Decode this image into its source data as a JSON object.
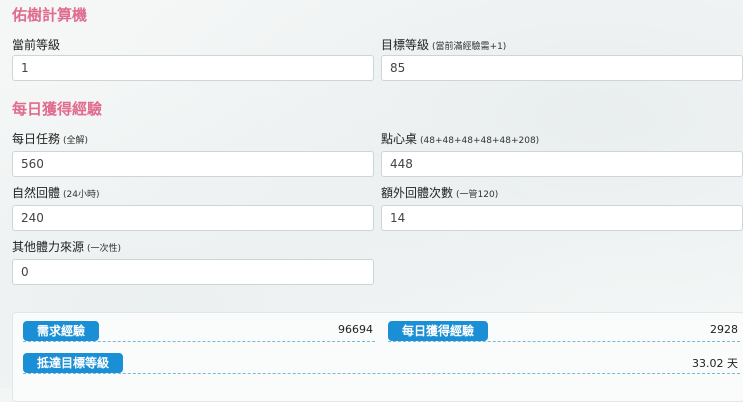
{
  "calculator": {
    "title": "佑樹計算機",
    "current_level_label": "當前等級",
    "current_level_value": "1",
    "target_level_label": "目標等級",
    "target_level_hint": "(當前滿經驗需+1)",
    "target_level_value": "85"
  },
  "daily_exp": {
    "title": "每日獲得經驗",
    "daily_tasks_label": "每日任務",
    "daily_tasks_hint": "(全解)",
    "daily_tasks_value": "560",
    "snacks_label": "點心桌",
    "snacks_hint": "(48+48+48+48+48+208)",
    "snacks_value": "448",
    "natural_recovery_label": "自然回體",
    "natural_recovery_hint": "(24小時)",
    "natural_recovery_value": "240",
    "extra_recovery_label": "額外回體次數",
    "extra_recovery_hint": "(一管120)",
    "extra_recovery_value": "14",
    "other_stamina_label": "其他體力來源",
    "other_stamina_hint": "(一次性)",
    "other_stamina_value": "0"
  },
  "results": {
    "required_exp_label": "需求經驗",
    "required_exp_value": "96694",
    "daily_exp_label": "每日獲得經驗",
    "daily_exp_value": "2928",
    "reach_target_label": "抵達目標等級",
    "reach_target_value": "33.02 天"
  }
}
